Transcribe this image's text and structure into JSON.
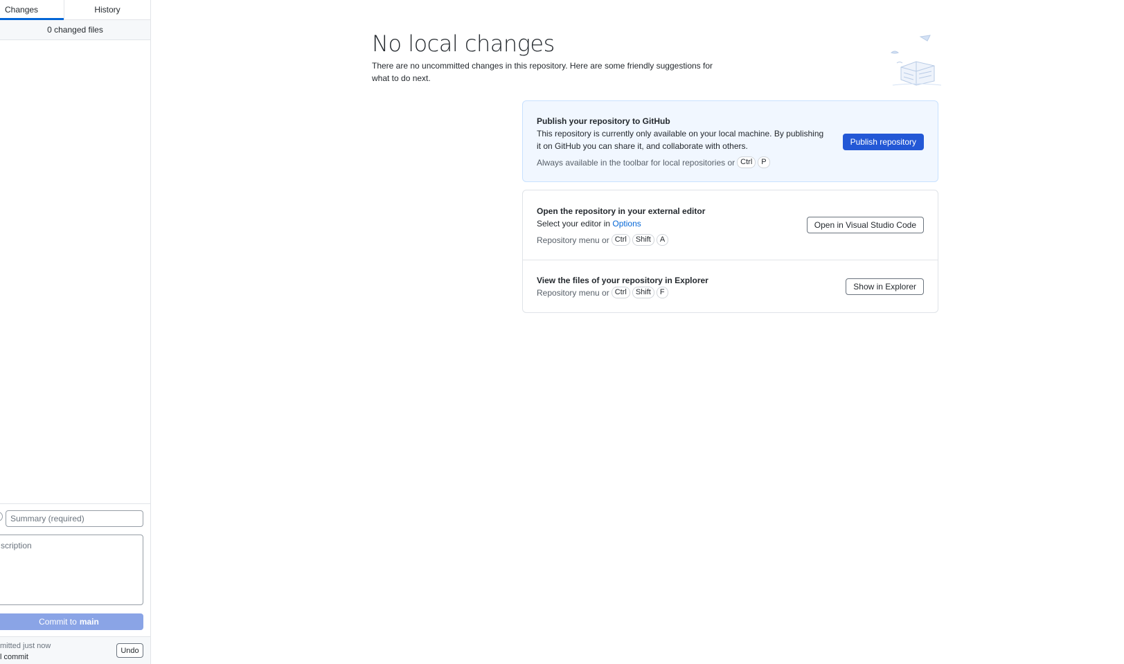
{
  "sidebar": {
    "tabs": [
      {
        "label": "Changes",
        "selected": true
      },
      {
        "label": "History",
        "selected": false
      }
    ],
    "changed_files": "0 changed files",
    "commit": {
      "summary_placeholder": "Summary (required)",
      "description_placeholder": "scription",
      "button_prefix": "Commit to",
      "branch": "main"
    },
    "undo": {
      "line1": "mitted just now",
      "line2": "l commit",
      "button": "Undo"
    }
  },
  "main": {
    "title": "No local changes",
    "subtitle": "There are no uncommitted changes in this repository. Here are some friendly suggestions for what to do next.",
    "publish": {
      "title": "Publish your repository to GitHub",
      "description": "This repository is currently only available on your local machine. By publishing it on GitHub you can share it, and collaborate with others.",
      "hint": "Always available in the toolbar for local repositories or",
      "keys": [
        "Ctrl",
        "P"
      ],
      "button": "Publish repository"
    },
    "editor": {
      "title": "Open the repository in your external editor",
      "description_prefix": "Select your editor in",
      "description_link": "Options",
      "hint": "Repository menu or",
      "keys": [
        "Ctrl",
        "Shift",
        "A"
      ],
      "button": "Open in Visual Studio Code"
    },
    "explorer": {
      "title": "View the files of your repository in Explorer",
      "hint": "Repository menu or",
      "keys": [
        "Ctrl",
        "Shift",
        "F"
      ],
      "button": "Show in Explorer"
    }
  },
  "colors": {
    "accent": "#0366d6",
    "publish_button": "#2358d6",
    "commit_button_disabled": "#8aa4e6",
    "publish_card_bg": "#f1f7ff"
  }
}
